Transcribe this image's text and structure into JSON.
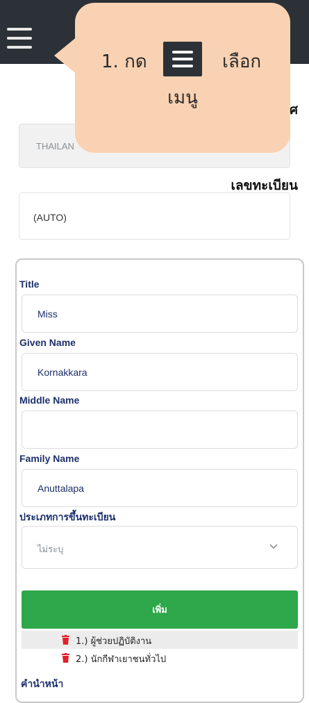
{
  "header": {
    "menu_icon": "hamburger-icon"
  },
  "tooltip": {
    "step": "1. กด",
    "action": "เลือก",
    "line2": "เมนู"
  },
  "partial_label_top": "ศ",
  "country_field": {
    "value": "THAILAN"
  },
  "registration": {
    "label": "เลขทะเบียน",
    "value": "(AUTO)"
  },
  "form": {
    "title_label": "Title",
    "title_value": "Miss",
    "given_label": "Given Name",
    "given_value": "Kornakkara",
    "middle_label": "Middle Name",
    "middle_value": "",
    "family_label": "Family Name",
    "family_value": "Anuttalapa",
    "regtype_label": "ประเภทการขึ้นทะเบียน",
    "regtype_value": "ไม่ระบุ",
    "add_button": "เพิ่ม",
    "list": [
      {
        "text": "1.) ผู้ช่วยปฏิบัติงาน"
      },
      {
        "text": "2.) นักกีฬาเยาชนทั่วไป"
      }
    ],
    "next_label": "คำนำหน้า"
  },
  "colors": {
    "topbar": "#2b3137",
    "add_button": "#2ea84a",
    "tooltip": "#f8d2b2",
    "label": "#1c2f6b",
    "trash": "#e0202a"
  }
}
